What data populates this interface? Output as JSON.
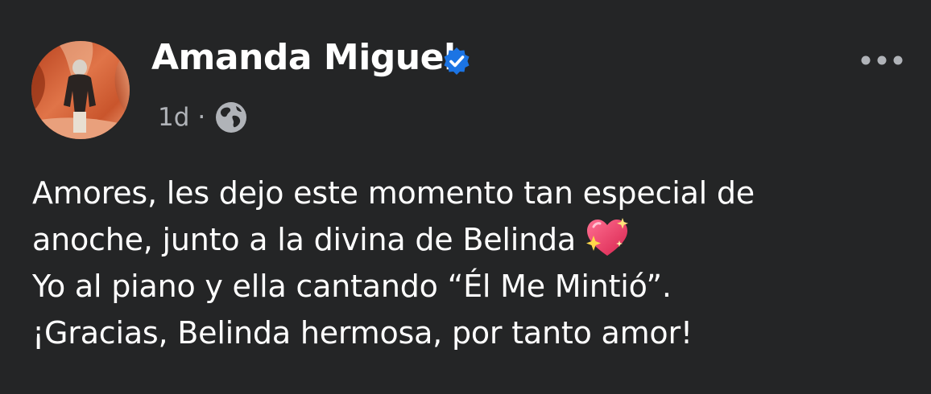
{
  "post": {
    "author": {
      "name": "Amanda Miguel",
      "verified_icon": "verified-badge-icon",
      "avatar_icon": "profile-photo"
    },
    "meta": {
      "timestamp": "1d",
      "separator": "·",
      "audience_icon": "globe-icon"
    },
    "menu_icon": "more-options-icon",
    "text_lines": [
      "Amores, les dejo este momento tan especial de",
      "anoche, junto a la divina de Belinda",
      "Yo al piano y ella cantando “Él Me Mintió”.",
      "¡Gracias, Belinda hermosa, por tanto amor!"
    ],
    "emoji": "sparkling-heart"
  },
  "colors": {
    "background": "#242526",
    "text": "#ffffff",
    "secondary_text": "#b0b3b8",
    "verified_blue": "#1b74e4"
  }
}
